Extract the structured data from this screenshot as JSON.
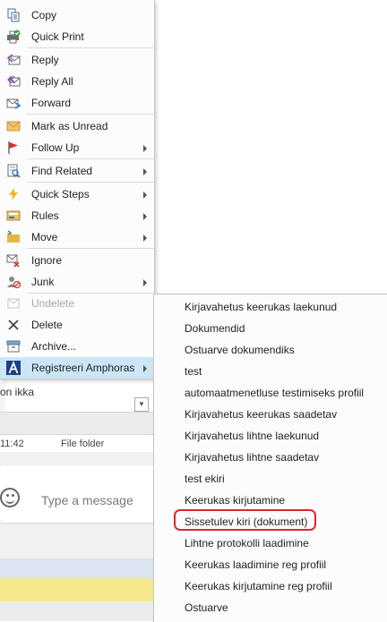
{
  "menu": {
    "items": [
      {
        "label": "Copy",
        "icon": "copy-icon"
      },
      {
        "label": "Quick Print",
        "icon": "quick-print-icon"
      },
      {
        "label": "Reply",
        "icon": "reply-icon"
      },
      {
        "label": "Reply All",
        "icon": "reply-all-icon"
      },
      {
        "label": "Forward",
        "icon": "forward-icon"
      },
      {
        "label": "Mark as Unread",
        "icon": "mark-unread-icon"
      },
      {
        "label": "Follow Up",
        "icon": "flag-icon"
      },
      {
        "label": "Find Related",
        "icon": "find-related-icon"
      },
      {
        "label": "Quick Steps",
        "icon": "lightning-icon"
      },
      {
        "label": "Rules",
        "icon": "rules-icon"
      },
      {
        "label": "Move",
        "icon": "move-folder-icon"
      },
      {
        "label": "Ignore",
        "icon": "ignore-icon"
      },
      {
        "label": "Junk",
        "icon": "junk-icon"
      },
      {
        "label": "Undelete",
        "icon": "undelete-icon"
      },
      {
        "label": "Delete",
        "icon": "delete-x-icon"
      },
      {
        "label": "Archive...",
        "icon": "archive-icon"
      },
      {
        "label": "Registreeri Amphoras",
        "icon": "amphora-a-icon"
      }
    ]
  },
  "submenu": {
    "items": [
      "Kirjavahetus keerukas laekunud",
      "Dokumendid",
      "Ostuarve dokumendiks",
      "test",
      "automaatmenetluse testimiseks profiil",
      "Kirjavahetus keerukas saadetav",
      "Kirjavahetus lihtne laekunud",
      "Kirjavahetus lihtne saadetav",
      "test ekiri",
      "Keerukas kirjutamine",
      "Sissetulev kiri (dokument)",
      "Lihtne protokolli laadimine",
      "Keerukas laadimine reg profiil",
      "Keerukas kirjutamine reg profiil",
      "Ostuarve"
    ],
    "circled_item": "Sissetulev kiri (dokument)"
  },
  "background": {
    "preview_text": "on ikka",
    "file_row_time": "11:42",
    "file_row_type": "File folder",
    "chat_placeholder": "Type a message"
  },
  "colors": {
    "highlight": "#cde6f7",
    "circle": "#e0262b",
    "yellow_band": "#f4e98a"
  }
}
